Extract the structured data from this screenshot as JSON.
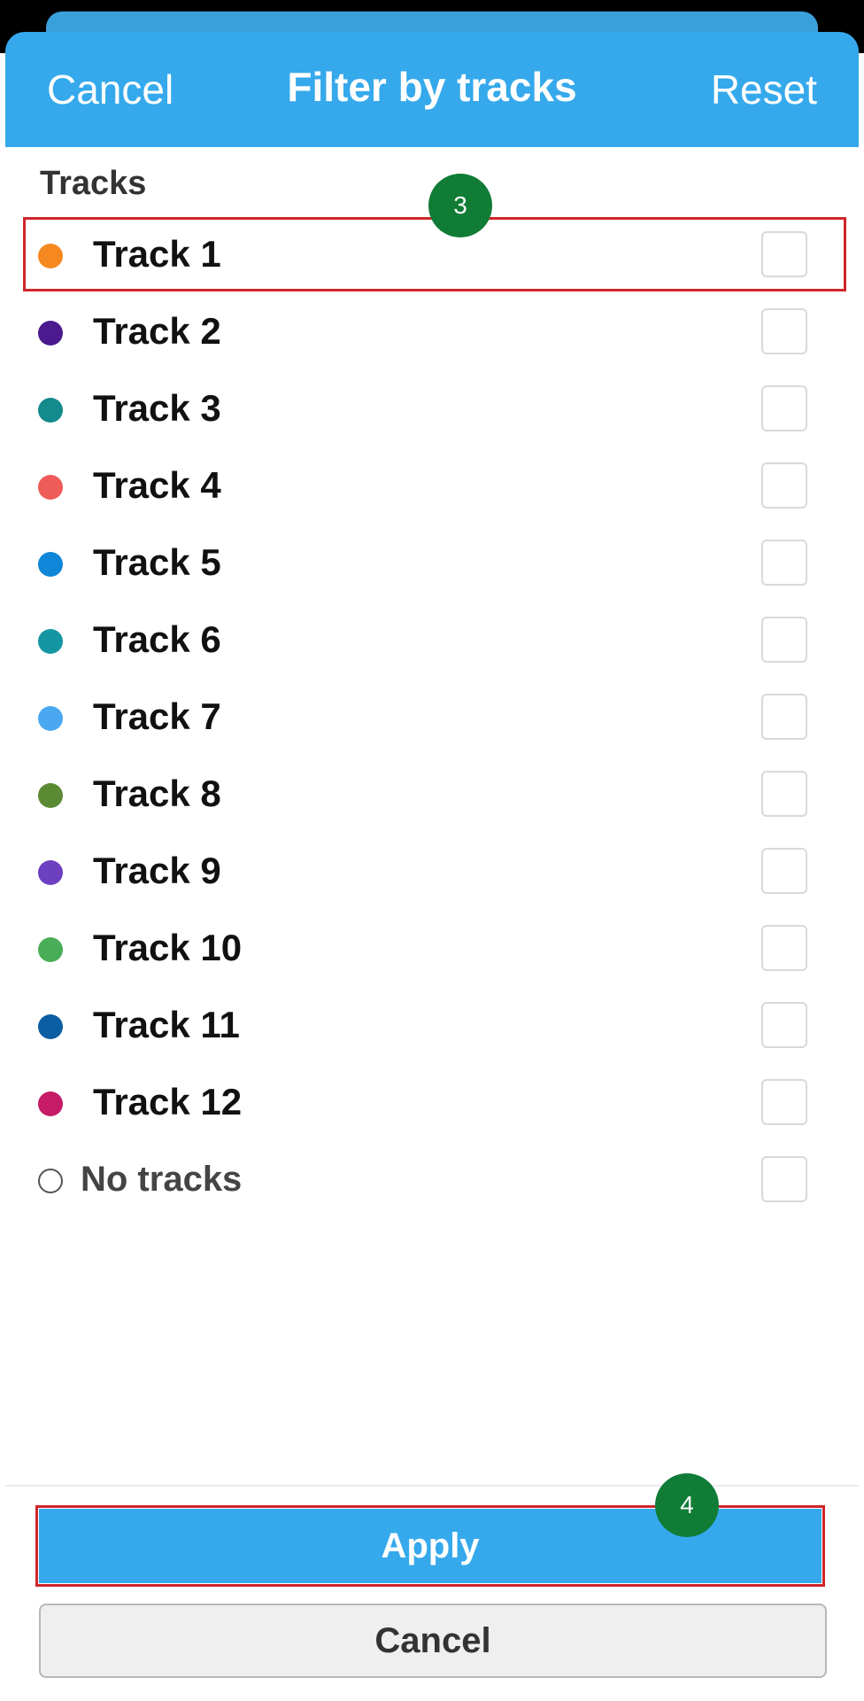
{
  "header": {
    "cancel_label": "Cancel",
    "title": "Filter by tracks",
    "reset_label": "Reset"
  },
  "section": {
    "title": "Tracks"
  },
  "tracks": [
    {
      "label": "Track 1",
      "color": "#f5881f",
      "checked": false
    },
    {
      "label": "Track 2",
      "color": "#4b1a8f",
      "checked": false
    },
    {
      "label": "Track 3",
      "color": "#138a8c",
      "checked": false
    },
    {
      "label": "Track 4",
      "color": "#ef5b59",
      "checked": false
    },
    {
      "label": "Track 5",
      "color": "#0f86d8",
      "checked": false
    },
    {
      "label": "Track 6",
      "color": "#1496a3",
      "checked": false
    },
    {
      "label": "Track 7",
      "color": "#4aa8f0",
      "checked": false
    },
    {
      "label": "Track 8",
      "color": "#5a8a34",
      "checked": false
    },
    {
      "label": "Track 9",
      "color": "#6d3fc1",
      "checked": false
    },
    {
      "label": "Track 10",
      "color": "#4aad57",
      "checked": false
    },
    {
      "label": "Track 11",
      "color": "#0c5ea4",
      "checked": false
    },
    {
      "label": "Track 12",
      "color": "#c61c67",
      "checked": false
    }
  ],
  "no_tracks": {
    "label": "No tracks",
    "checked": false
  },
  "markers": {
    "step3": "3",
    "step4": "4"
  },
  "footer": {
    "apply_label": "Apply",
    "cancel_label": "Cancel"
  },
  "colors": {
    "accent": "#35a9eb",
    "highlight": "#d0262a",
    "marker": "#107c36"
  }
}
